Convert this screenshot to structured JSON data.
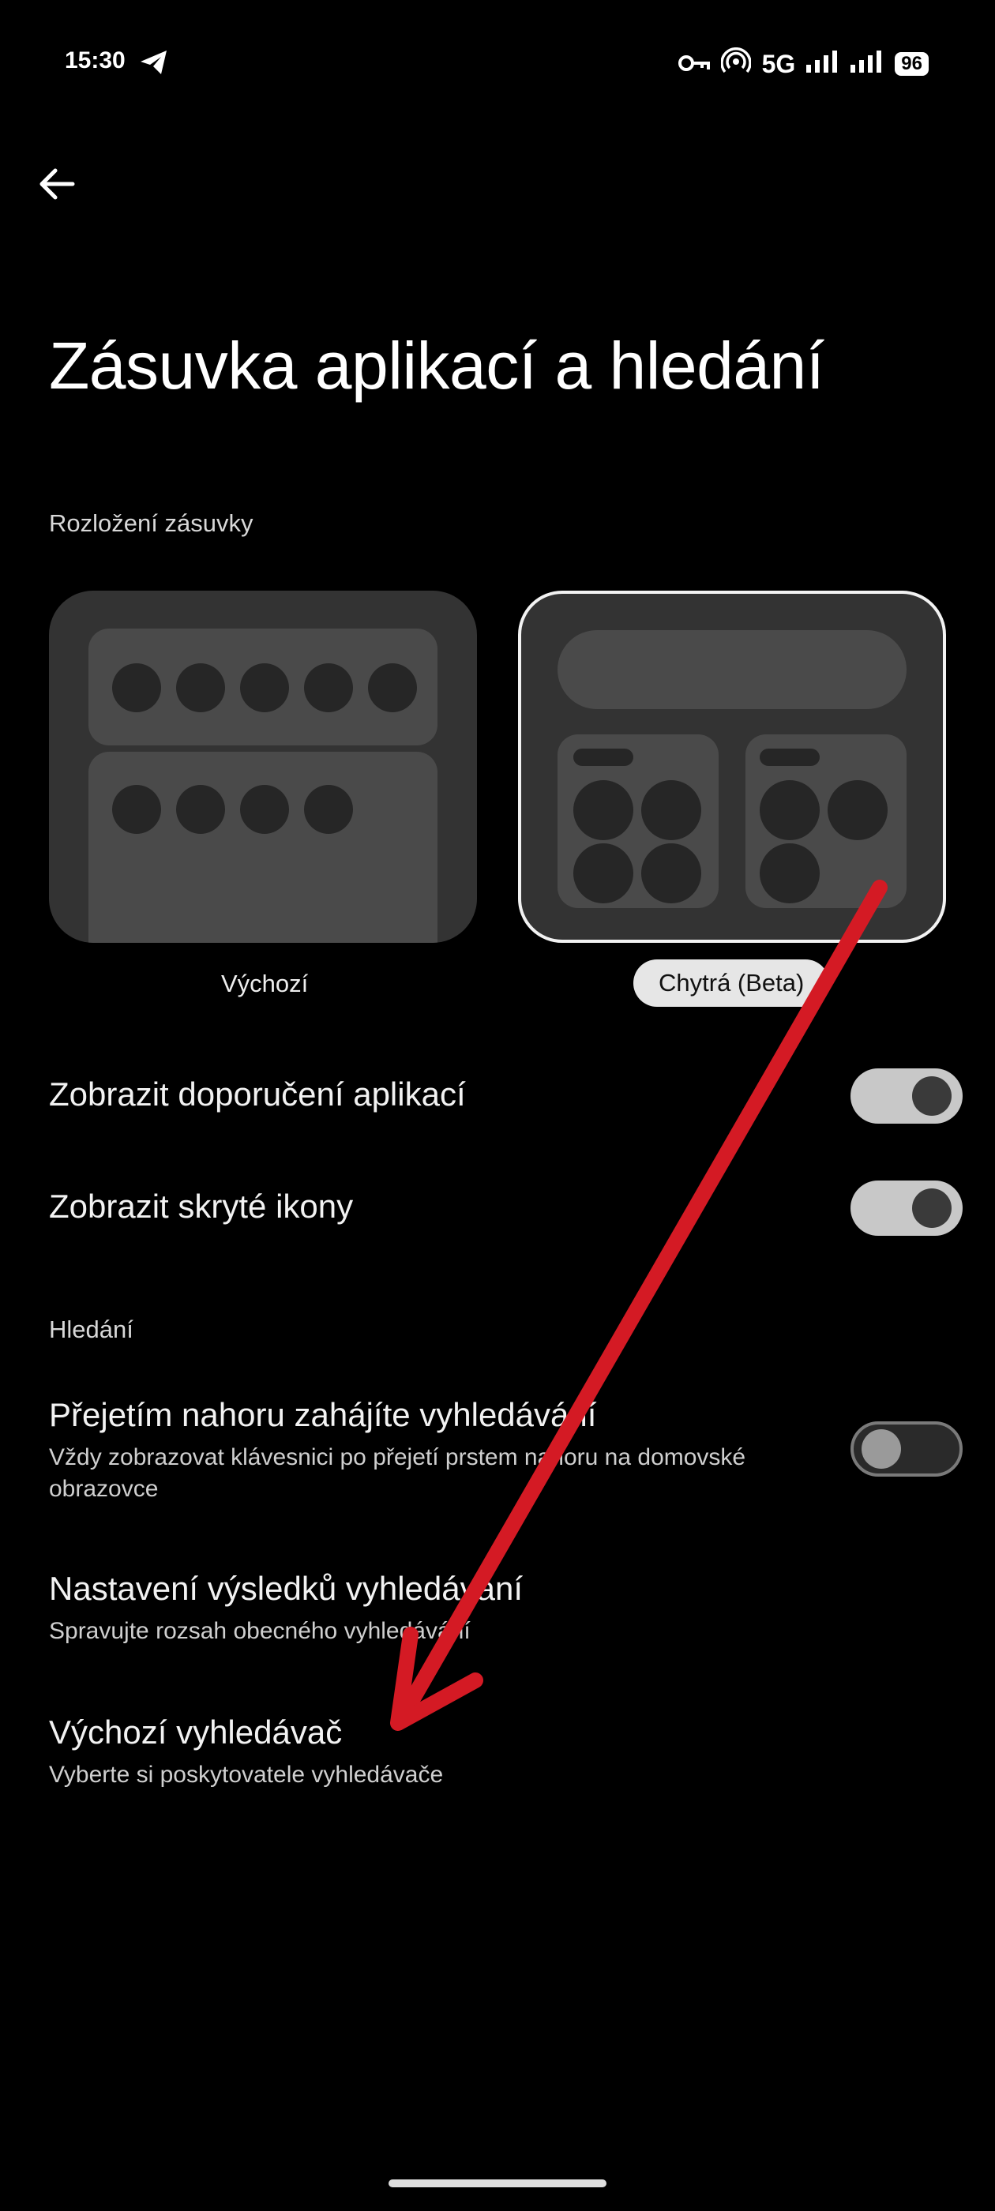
{
  "status_bar": {
    "time": "15:30",
    "network": "5G",
    "battery": "96",
    "icons": [
      "telegram-icon",
      "vpn-key-icon",
      "hotspot-icon",
      "signal-icon",
      "signal-icon",
      "battery-icon"
    ]
  },
  "header": {
    "back_icon": "arrow-back-icon",
    "title": "Zásuvka aplikací a hledání"
  },
  "drawer_layout": {
    "section_label": "Rozložení zásuvky",
    "options": [
      {
        "label": "Výchozí",
        "selected": false
      },
      {
        "label": "Chytrá (Beta)",
        "selected": true
      }
    ]
  },
  "settings": {
    "show_app_suggestions": {
      "title": "Zobrazit doporučení aplikací",
      "enabled": true
    },
    "show_hidden_icons": {
      "title": "Zobrazit skryté ikony",
      "enabled": true
    }
  },
  "search": {
    "section_label": "Hledání",
    "swipe_up": {
      "title": "Přejetím nahoru zahájíte vyhledávání",
      "subtitle": "Vždy zobrazovat klávesnici po přejetí prstem nahoru na domovské obrazovce",
      "enabled": false
    },
    "results_settings": {
      "title": "Nastavení výsledků vyhledávání",
      "subtitle": "Spravujte rozsah obecného vyhledávání"
    },
    "default_engine": {
      "title": "Výchozí vyhledávač",
      "subtitle": "Vyberte si poskytovatele vyhledávače"
    }
  },
  "annotation": {
    "color": "#d41a24"
  }
}
